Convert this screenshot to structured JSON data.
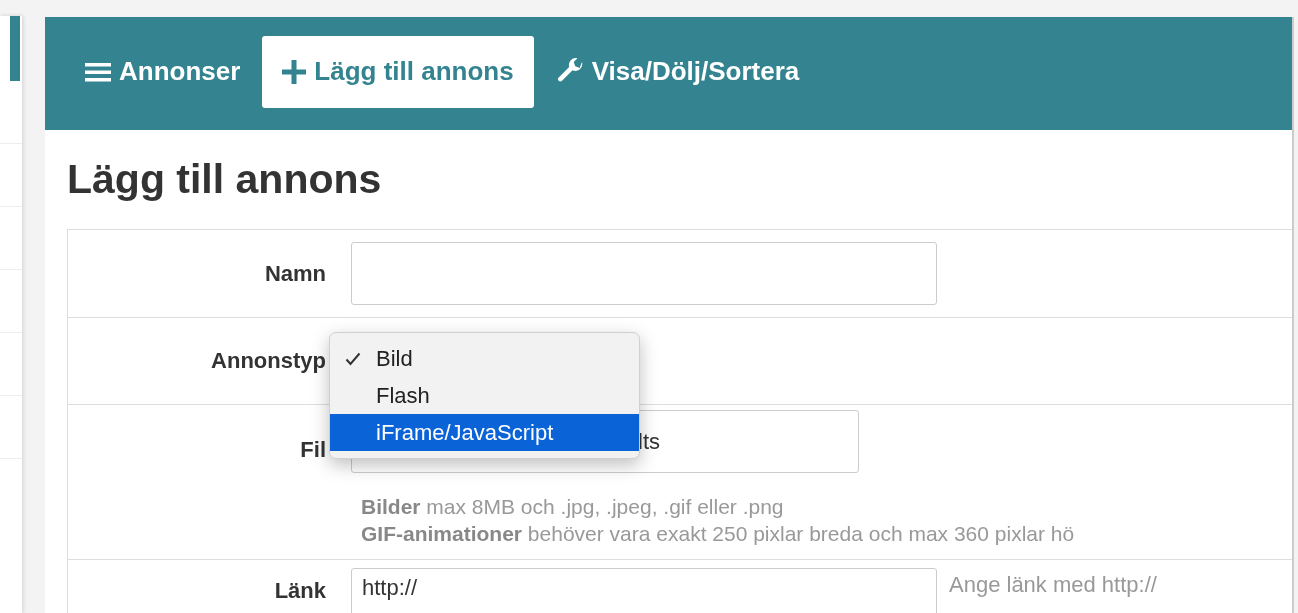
{
  "nav": {
    "items": [
      {
        "label": "Annonser",
        "kind": "menu",
        "selected": false
      },
      {
        "label": "Lägg till annons",
        "kind": "add",
        "selected": true
      },
      {
        "label": "Visa/Dölj/Sortera",
        "kind": "settings",
        "selected": false
      }
    ]
  },
  "heading": "Lägg till annons",
  "form": {
    "rows": [
      {
        "kind": "text",
        "label": "Namn",
        "value": ""
      },
      {
        "kind": "select",
        "label": "Annonstyp",
        "options": [
          {
            "label": "Bild",
            "checked": true,
            "selected": false
          },
          {
            "label": "Flash",
            "checked": false,
            "selected": false
          },
          {
            "label": "iFrame/JavaScript",
            "checked": false,
            "selected": true
          }
        ]
      },
      {
        "kind": "file",
        "label": "Fil",
        "value": "lts",
        "hints": [
          "**Bilder** max 8MB och .jpg, .jpeg, .gif eller .png",
          "**GIF-animationer** behöver vara exakt 250 pixlar breda och max 360 pixlar hö"
        ]
      },
      {
        "kind": "link",
        "label": "Länk",
        "value": "http://",
        "help": "Ange länk med http://"
      }
    ]
  }
}
